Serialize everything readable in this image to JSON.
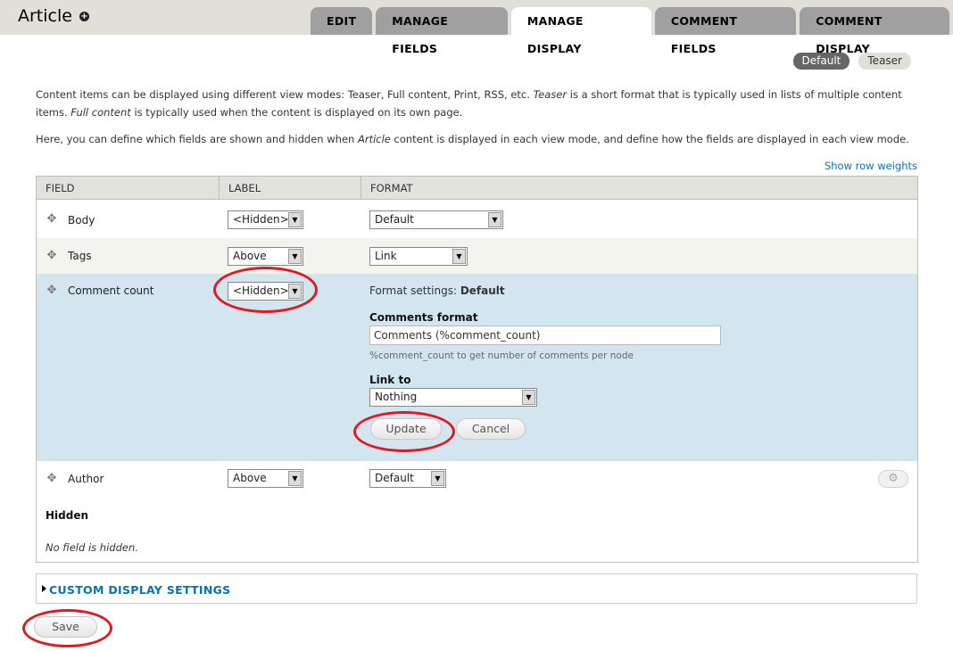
{
  "header": {
    "title": "Article",
    "tabs": [
      {
        "label": "EDIT"
      },
      {
        "label": "MANAGE FIELDS"
      },
      {
        "label": "MANAGE DISPLAY",
        "active": true
      },
      {
        "label": "COMMENT FIELDS"
      },
      {
        "label": "COMMENT DISPLAY"
      }
    ]
  },
  "view_modes": [
    {
      "label": "Default",
      "active": true
    },
    {
      "label": "Teaser",
      "active": false
    }
  ],
  "description": {
    "p1_a": "Content items can be displayed using different view modes: Teaser, Full content, Print, RSS, etc. ",
    "p1_teaser": "Teaser",
    "p1_b": " is a short format that is typically used in lists of multiple content items. ",
    "p1_full": "Full content",
    "p1_c": " is typically used when the content is displayed on its own page.",
    "p2_a": "Here, you can define which fields are shown and hidden when ",
    "p2_article": "Article",
    "p2_b": " content is displayed in each view mode, and define how the fields are displayed in each view mode."
  },
  "show_row_weights": "Show row weights",
  "table": {
    "headers": {
      "field": "FIELD",
      "label": "LABEL",
      "format": "FORMAT"
    },
    "rows": [
      {
        "name": "Body",
        "label": "<Hidden>",
        "format": "Default"
      },
      {
        "name": "Tags",
        "label": "Above",
        "format": "Link"
      },
      {
        "name": "Comment count",
        "label": "<Hidden>"
      },
      {
        "name": "Author",
        "label": "Above",
        "format": "Default"
      }
    ],
    "format_settings": {
      "prefix": "Format settings:",
      "value": "Default",
      "comments_format_label": "Comments format",
      "comments_format_value": "Comments (%comment_count)",
      "comments_format_hint": "%comment_count to get number of comments per node",
      "link_to_label": "Link to",
      "link_to_value": "Nothing",
      "update_label": "Update",
      "cancel_label": "Cancel"
    },
    "hidden_region": {
      "title": "Hidden",
      "empty": "No field is hidden."
    }
  },
  "custom_display_settings": "CUSTOM DISPLAY SETTINGS",
  "save_label": "Save",
  "colors": {
    "accent_link": "#0074bd",
    "highlight_row": "#d3e5ef",
    "annotation_red": "#e01a22"
  }
}
